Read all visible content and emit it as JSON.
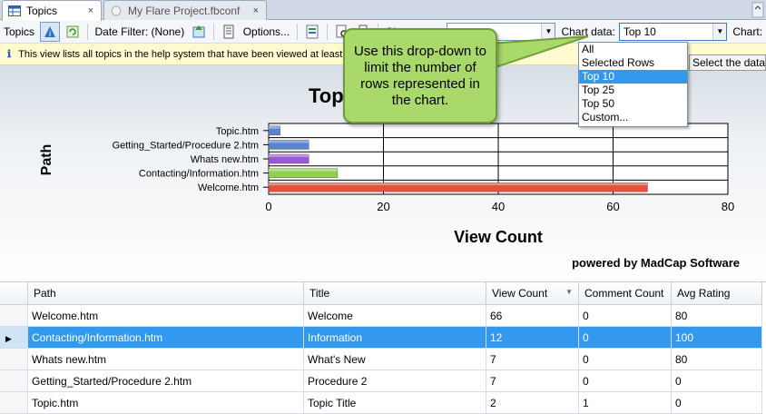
{
  "tabs": [
    {
      "label": "Topics",
      "close": "×"
    },
    {
      "label": "My Flare Project.fbconf",
      "close": "×"
    }
  ],
  "toolbar": {
    "topics_label": "Topics",
    "date_filter_label": "Date Filter: (None)",
    "options_label": "Options...",
    "show_label": "Sh",
    "chart_data_label": "Chart data:",
    "chart_data_value": "Top 10",
    "chart_label": "Chart:"
  },
  "infobar": {
    "text": "This view lists all topics in the help system that have been viewed at least"
  },
  "dropdown": {
    "options": [
      "All",
      "Selected Rows",
      "Top 10",
      "Top 25",
      "Top 50",
      "Custom..."
    ],
    "selected": "Top 10"
  },
  "tooltip": {
    "text": "Select the data"
  },
  "callout": {
    "text": "Use this drop-down to limit the number of rows represented in the chart."
  },
  "chart": {
    "title": "Top",
    "watermark": "powered by MadCap Software"
  },
  "chart_data": {
    "type": "bar",
    "orientation": "horizontal",
    "title": "Top",
    "xlabel": "View Count",
    "ylabel": "Path",
    "categories": [
      "Topic.htm",
      "Getting_Started/Procedure 2.htm",
      "Whats new.htm",
      "Contacting/Information.htm",
      "Welcome.htm"
    ],
    "values": [
      2,
      7,
      7,
      12,
      66
    ],
    "colors": [
      "#5a84d2",
      "#5a84d2",
      "#9a5ad8",
      "#8fd24a",
      "#e0533c"
    ],
    "xlim": [
      0,
      80
    ],
    "xticks": [
      "0",
      "20",
      "40",
      "60",
      "80"
    ],
    "grid": true
  },
  "grid": {
    "columns": [
      "Path",
      "Title",
      "View Count",
      "Comment Count",
      "Avg Rating"
    ],
    "rows": [
      [
        "Welcome.htm",
        "Welcome",
        "66",
        "0",
        "80"
      ],
      [
        "Contacting/Information.htm",
        "Information",
        "12",
        "0",
        "100"
      ],
      [
        "Whats new.htm",
        "What's New",
        "7",
        "0",
        "80"
      ],
      [
        "Getting_Started/Procedure 2.htm",
        "Procedure 2",
        "7",
        "0",
        "0"
      ],
      [
        "Topic.htm",
        "Topic Title",
        "2",
        "1",
        "0"
      ]
    ],
    "selected_row": 1
  }
}
